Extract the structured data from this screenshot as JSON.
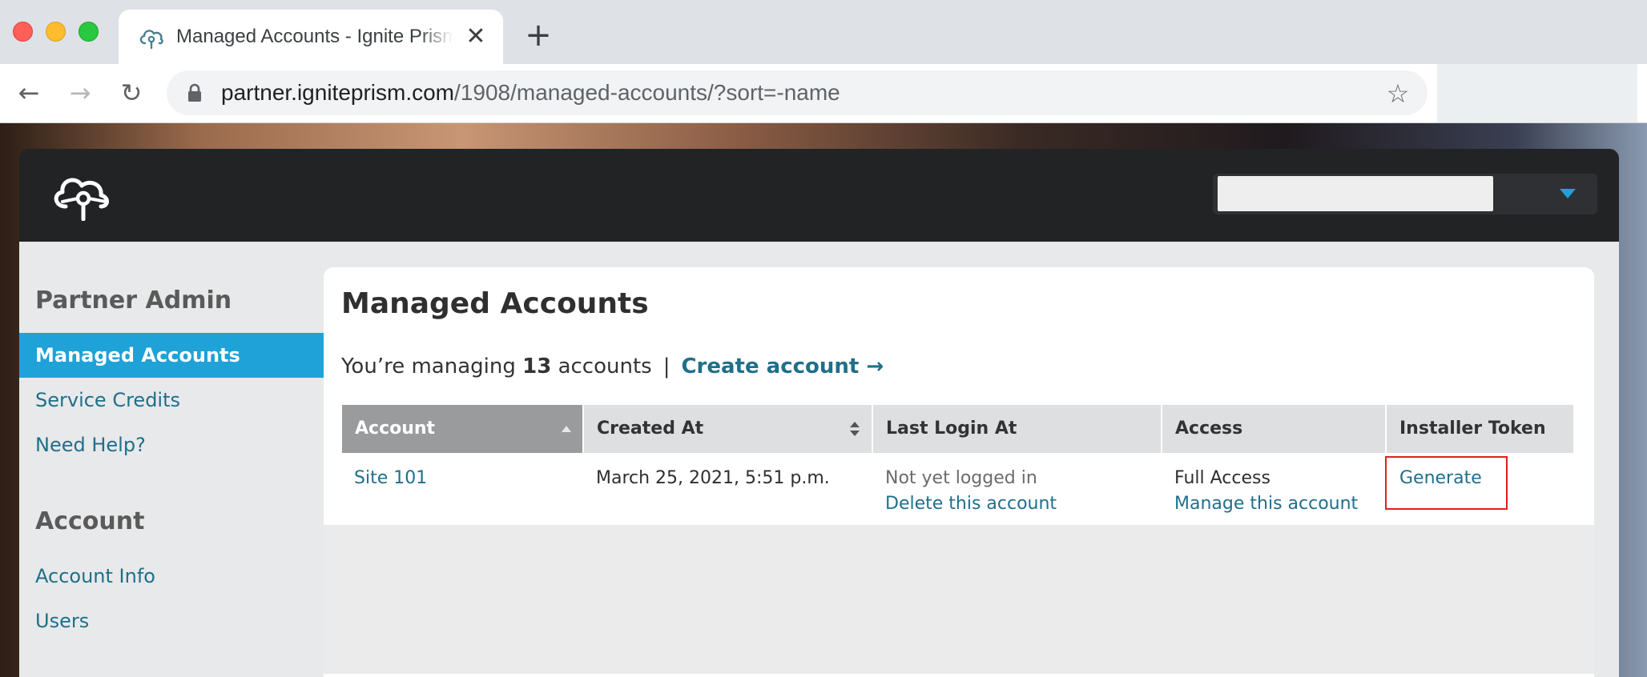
{
  "browser": {
    "tab_title": "Managed Accounts - Ignite Prism",
    "tab_close": "✕",
    "new_tab": "+",
    "url_host": "partner.igniteprism.com",
    "url_path": "/1908/managed-accounts/?sort=-name",
    "nav_back": "←",
    "nav_forward": "→",
    "nav_reload": "↻",
    "bookmark_star": "☆"
  },
  "header": {
    "logo": "cloud-pin-logo",
    "account_selector_value": ""
  },
  "sidebar": {
    "sections": [
      {
        "heading": "Partner Admin",
        "items": [
          {
            "label": "Managed Accounts",
            "active": true
          },
          {
            "label": "Service Credits",
            "active": false
          },
          {
            "label": "Need Help?",
            "active": false
          }
        ]
      },
      {
        "heading": "Account",
        "items": [
          {
            "label": "Account Info",
            "active": false
          },
          {
            "label": "Users",
            "active": false
          }
        ]
      }
    ]
  },
  "main": {
    "title": "Managed Accounts",
    "summary_prefix": "You’re managing",
    "summary_count": "13",
    "summary_suffix": "accounts",
    "summary_separator": "|",
    "create_link": "Create account →",
    "table": {
      "columns": [
        "Account",
        "Created At",
        "Last Login At",
        "Access",
        "Installer Token"
      ],
      "rows": [
        {
          "account": "Site 101",
          "created_at": "March 25, 2021, 5:51 p.m.",
          "last_login": "Not yet logged in",
          "delete_link": "Delete this account",
          "access": "Full Access",
          "manage_link": "Manage this account",
          "token_action": "Generate"
        }
      ]
    }
  },
  "colors": {
    "accent": "#1fa2d8",
    "link": "#1f6f8b",
    "header_bg": "#222325",
    "highlight_border": "#e02020"
  }
}
